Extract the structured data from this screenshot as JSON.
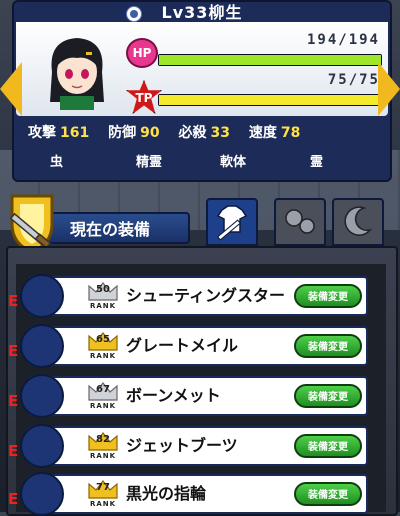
{
  "character": {
    "level_name": "Lv33柳生",
    "hp_label": "HP",
    "hp_text": "194/194",
    "hp_fraction": 1.0,
    "tp_label": "TP",
    "tp_text": "75/75",
    "tp_fraction": 1.0,
    "stats": [
      {
        "label": "攻撃",
        "value": "161"
      },
      {
        "label": "防御",
        "value": "90"
      },
      {
        "label": "必殺",
        "value": "33"
      },
      {
        "label": "速度",
        "value": "78"
      }
    ],
    "types": [
      "虫",
      "精霊",
      "軟体",
      "霊"
    ]
  },
  "equipment": {
    "header": "現在の装備",
    "items": [
      {
        "slot_mark": "E",
        "rank": "50",
        "rank_tier": "silver",
        "rank_label": "RANK",
        "name": "シューティングスター",
        "button": "装備変更",
        "slot_icon": "knuckle-icon"
      },
      {
        "slot_mark": "E",
        "rank": "65",
        "rank_tier": "gold",
        "rank_label": "RANK",
        "name": "グレートメイル",
        "button": "装備変更",
        "slot_icon": "shirt-icon"
      },
      {
        "slot_mark": "E",
        "rank": "67",
        "rank_tier": "silver",
        "rank_label": "RANK",
        "name": "ボーンメット",
        "button": "装備変更",
        "slot_icon": "helmet-icon"
      },
      {
        "slot_mark": "E",
        "rank": "82",
        "rank_tier": "gold",
        "rank_label": "RANK",
        "name": "ジェットブーツ",
        "button": "装備変更",
        "slot_icon": "boot-icon"
      },
      {
        "slot_mark": "E",
        "rank": "77",
        "rank_tier": "gold",
        "rank_label": "RANK",
        "name": "黒光の指輪",
        "button": "装備変更",
        "slot_icon": "ring-icon"
      }
    ]
  },
  "colors": {
    "hp_fill": "#9ee62a",
    "tp_fill": "#f3ea2c",
    "accent": "#1e3f8a"
  }
}
